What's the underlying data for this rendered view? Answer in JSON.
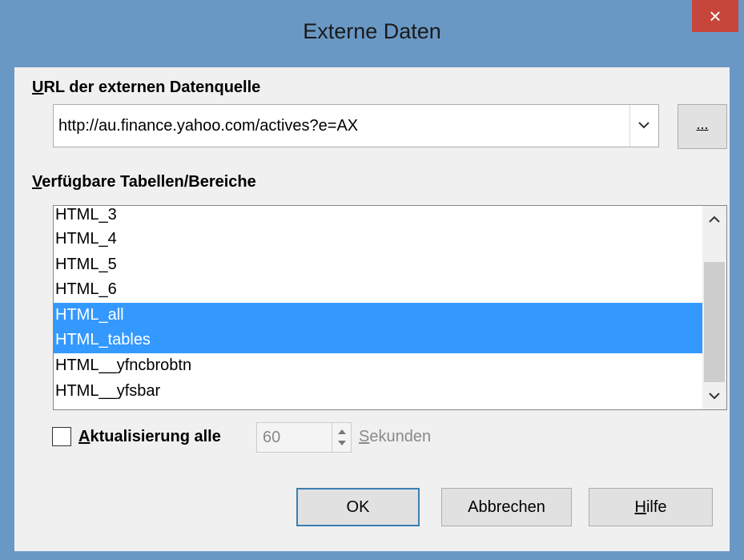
{
  "window": {
    "title": "Externe Daten",
    "close_label": "×"
  },
  "url_section": {
    "label_accesskey": "U",
    "label_rest": "RL der externen Datenquelle",
    "url_value": "http://au.finance.yahoo.com/actives?e=AX",
    "browse_label": "..."
  },
  "tables_section": {
    "label_accesskey": "V",
    "label_rest": "erfügbare Tabellen/Bereiche",
    "items": [
      {
        "label": "HTML_3",
        "selected": false
      },
      {
        "label": "HTML_4",
        "selected": false
      },
      {
        "label": "HTML_5",
        "selected": false
      },
      {
        "label": "HTML_6",
        "selected": false
      },
      {
        "label": "HTML_all",
        "selected": true
      },
      {
        "label": "HTML_tables",
        "selected": true
      },
      {
        "label": "HTML__yfncbrobtn",
        "selected": false
      },
      {
        "label": "HTML__yfsbar",
        "selected": false
      }
    ]
  },
  "update": {
    "checked": false,
    "label_accesskey": "A",
    "label_rest": "ktualisierung alle",
    "interval_value": "60",
    "unit_accesskey": "S",
    "unit_rest": "ekunden"
  },
  "buttons": {
    "ok": "OK",
    "cancel": "Abbrechen",
    "help_accesskey": "H",
    "help_rest": "ilfe"
  },
  "colors": {
    "titlebar": "#6a98c5",
    "close": "#c7463b",
    "selection": "#3399ff"
  }
}
